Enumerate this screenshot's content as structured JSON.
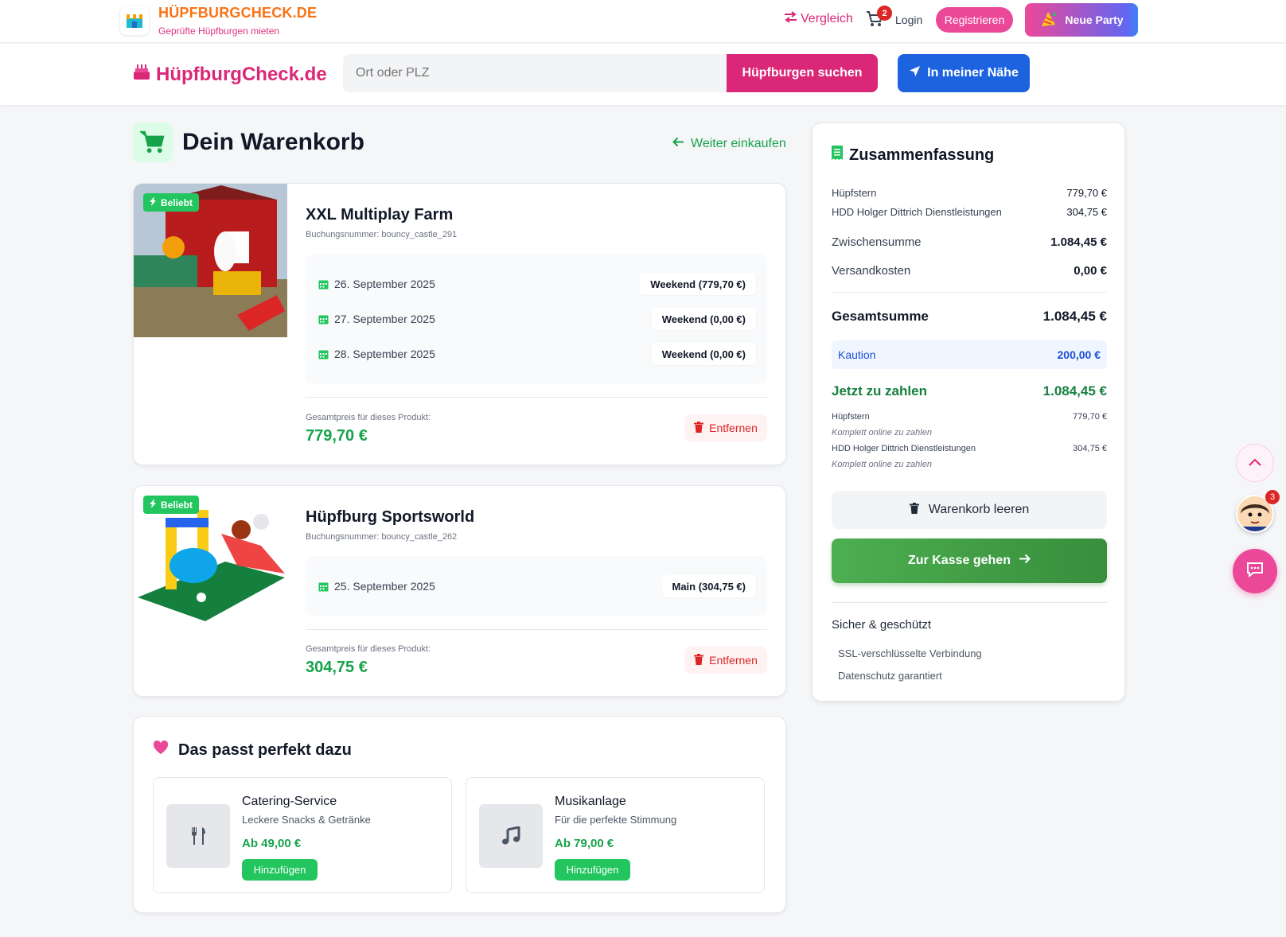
{
  "topbar": {
    "brand_name": "HÜPFBURGCHECK.DE",
    "brand_tagline": "Geprüfte Hüpfburgen mieten",
    "compare_label": "Vergleich",
    "cart_count": "2",
    "login_label": "Login",
    "register_label": "Registrieren",
    "new_party_label": "Neue Party"
  },
  "header": {
    "logo_text": "HüpfburgCheck.de",
    "search_placeholder": "Ort oder PLZ",
    "search_button": "Hüpfburgen suchen",
    "nearby_button": "In meiner Nähe"
  },
  "cart": {
    "title": "Dein Warenkorb",
    "continue_label": "Weiter einkaufen",
    "total_label": "Gesamtpreis für dieses Produkt:",
    "remove_label": "Entfernen",
    "badge_label": "Beliebt",
    "items": [
      {
        "name": "XXL Multiplay Farm",
        "booking": "Buchungsnummer: bouncy_castle_291",
        "dates": [
          {
            "date": "26. September 2025",
            "rate": "Weekend (779,70 €)"
          },
          {
            "date": "27. September 2025",
            "rate": "Weekend (0,00 €)"
          },
          {
            "date": "28. September 2025",
            "rate": "Weekend (0,00 €)"
          }
        ],
        "total": "779,70 €"
      },
      {
        "name": "Hüpfburg Sportsworld",
        "booking": "Buchungsnummer: bouncy_castle_262",
        "dates": [
          {
            "date": "25. September 2025",
            "rate": "Main (304,75 €)"
          }
        ],
        "total": "304,75 €"
      }
    ]
  },
  "upsell": {
    "title": "Das passt perfekt dazu",
    "add_label": "Hinzufügen",
    "items": [
      {
        "name": "Catering-Service",
        "desc": "Leckere Snacks & Getränke",
        "price": "Ab 49,00 €",
        "icon": "utensils-icon"
      },
      {
        "name": "Musikanlage",
        "desc": "Für die perfekte Stimmung",
        "price": "Ab 79,00 €",
        "icon": "music-note-icon"
      }
    ]
  },
  "summary": {
    "title": "Zusammenfassung",
    "vendors": [
      {
        "name": "Hüpfstern",
        "amount": "779,70 €"
      },
      {
        "name": "HDD Holger Dittrich Dienstleistungen",
        "amount": "304,75 €"
      }
    ],
    "subtotal_label": "Zwischensumme",
    "subtotal": "1.084,45 €",
    "shipping_label": "Versandkosten",
    "shipping": "0,00 €",
    "grand_label": "Gesamtsumme",
    "grand": "1.084,45 €",
    "deposit_label": "Kaution",
    "deposit": "200,00 €",
    "pay_now_label": "Jetzt zu zahlen",
    "pay_now": "1.084,45 €",
    "online_note": "Komplett online zu zahlen",
    "clear_label": "Warenkorb leeren",
    "checkout_label": "Zur Kasse gehen",
    "secure_title": "Sicher & geschützt",
    "secure_items": [
      "SSL-verschlüsselte Verbindung",
      "Datenschutz garantiert"
    ]
  },
  "floating": {
    "avatar_badge": "3"
  },
  "colors": {
    "brand_pink": "#db2777",
    "brand_orange": "#f97316",
    "success_green": "#16a34a",
    "primary_blue": "#1d63e0"
  }
}
